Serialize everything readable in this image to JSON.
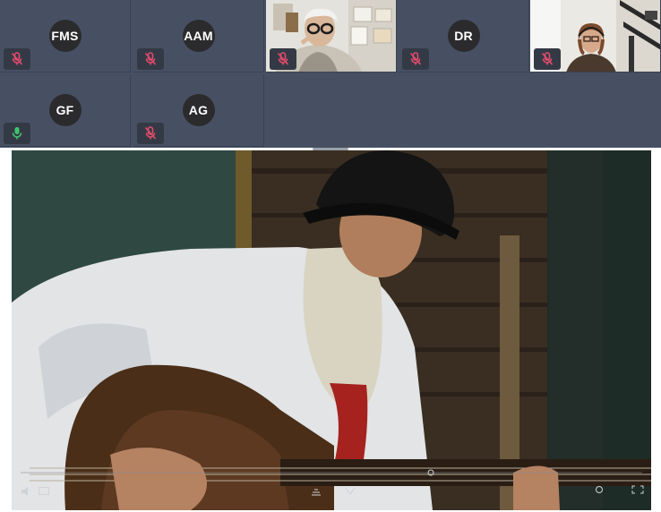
{
  "participants": [
    {
      "initials": "FMS",
      "mic": "muted"
    },
    {
      "initials": "AAM",
      "mic": "muted"
    },
    {
      "initials": "",
      "mic": "muted",
      "video": true
    },
    {
      "initials": "DR",
      "mic": "muted"
    },
    {
      "initials": "",
      "mic": "muted",
      "video": true
    },
    {
      "initials": "GF",
      "mic": "active"
    },
    {
      "initials": "AG",
      "mic": "muted"
    }
  ],
  "colors": {
    "panel": "#475063",
    "avatar": "#2b2b2d",
    "muted_mic": "#e34b6d",
    "active_mic": "#3ec46d"
  },
  "icons": {
    "muted": "mic-off-icon",
    "active": "mic-icon"
  }
}
